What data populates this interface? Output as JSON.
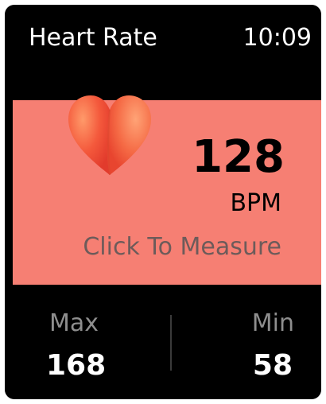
{
  "header": {
    "title": "Heart Rate",
    "time": "10:09"
  },
  "measurement": {
    "value": "128",
    "unit": "BPM",
    "action_label": "Click To Measure",
    "icon": "heart-icon",
    "panel_color": "#f67f73"
  },
  "stats": {
    "max": {
      "label": "Max",
      "value": "168"
    },
    "min": {
      "label": "Min",
      "value": "58"
    }
  }
}
